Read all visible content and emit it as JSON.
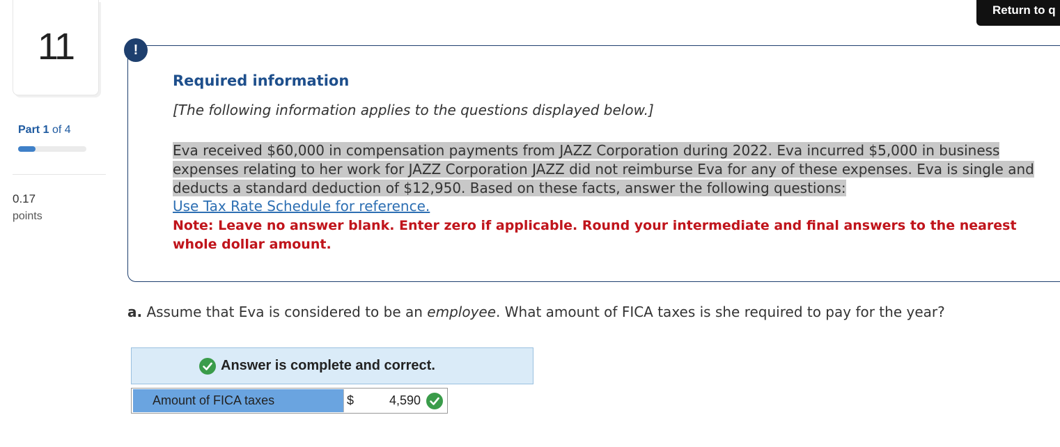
{
  "question_number": "11",
  "part": {
    "label": "Part",
    "current": "1",
    "of_text": "of 4",
    "progress_fraction": 0.25
  },
  "points": {
    "value": "0.17",
    "label": "points"
  },
  "return_button": "Return to q",
  "info": {
    "badge": "!",
    "title": "Required information",
    "subtitle": "[The following information applies to the questions displayed below.]",
    "scenario": "Eva received $60,000 in compensation payments from JAZZ Corporation during 2022. Eva incurred $5,000 in business expenses relating to her work for JAZZ Corporation JAZZ did not reimburse Eva for any of these expenses. Eva is single and deducts a standard deduction of $12,950. Based on these facts, answer the following questions:",
    "link": "Use Tax Rate Schedule for reference.",
    "note": "Note: Leave no answer blank. Enter zero if applicable. Round your intermediate and final answers to the nearest whole dollar amount."
  },
  "question": {
    "letter": "a.",
    "text_before": "Assume that Eva is considered to be an",
    "emphasis": "employee",
    "text_after": ". What amount of FICA taxes is she required to pay for the year?"
  },
  "answer": {
    "status": "Answer is complete and correct.",
    "row_label": "Amount of FICA taxes",
    "currency": "$",
    "value": "4,590"
  },
  "colors": {
    "accent": "#1e3f6e",
    "note_red": "#c0141b",
    "correct_green": "#3a9c4a",
    "banner_blue": "#daebf8"
  }
}
